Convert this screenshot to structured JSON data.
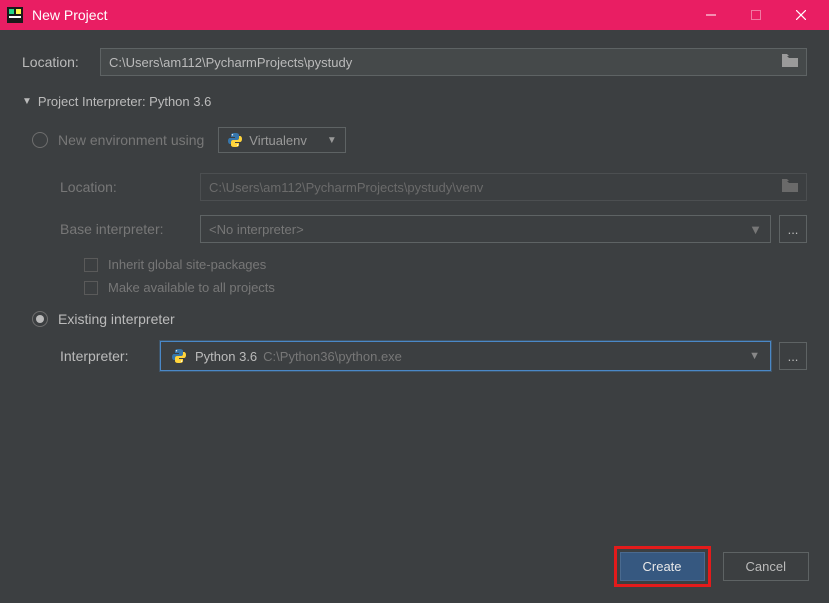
{
  "window": {
    "title": "New Project"
  },
  "location": {
    "label": "Location:",
    "value": "C:\\Users\\am112\\PycharmProjects\\pystudy"
  },
  "section": {
    "title": "Project Interpreter: Python 3.6"
  },
  "newEnv": {
    "label": "New environment using",
    "tool": "Virtualenv",
    "locationLabel": "Location:",
    "locationValue": "C:\\Users\\am112\\PycharmProjects\\pystudy\\venv",
    "baseInterpLabel": "Base interpreter:",
    "baseInterpValue": "<No interpreter>",
    "inheritLabel": "Inherit global site-packages",
    "makeAvailLabel": "Make available to all projects"
  },
  "existing": {
    "label": "Existing interpreter",
    "interpLabel": "Interpreter:",
    "name": "Python 3.6",
    "path": "C:\\Python36\\python.exe"
  },
  "buttons": {
    "create": "Create",
    "cancel": "Cancel"
  }
}
